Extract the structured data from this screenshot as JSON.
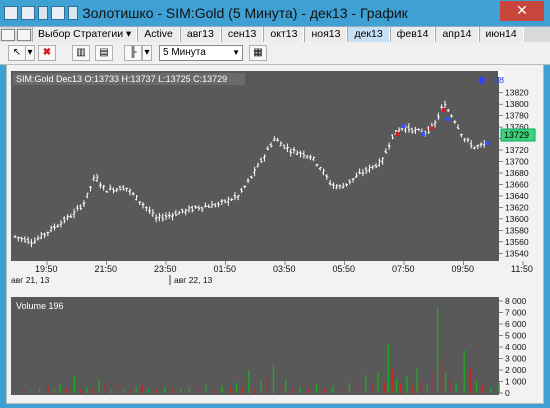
{
  "window": {
    "title": "Золотишко - SIM:Gold (5 Минута) - дек13 - График",
    "close_label": "✕"
  },
  "tabs": [
    {
      "label": "Выбор Стратегии",
      "dropdown": true
    },
    {
      "label": "Active"
    },
    {
      "label": "авг13"
    },
    {
      "label": "сен13"
    },
    {
      "label": "окт13"
    },
    {
      "label": "ноя13"
    },
    {
      "label": "дек13",
      "active": true
    },
    {
      "label": "фев14"
    },
    {
      "label": "апр14"
    },
    {
      "label": "июн14"
    }
  ],
  "toolbar": {
    "delete_icon": "✖",
    "interval_value": "5 Минута"
  },
  "chart": {
    "info_label": "SIM:Gold Dec13 O:13733 H:13737 L:13725 C:13729",
    "price_labels": [
      "13820",
      "13800",
      "13780",
      "13760",
      "13740",
      "13720",
      "13700",
      "13680",
      "13660",
      "13640",
      "13620",
      "13600",
      "13580",
      "13560",
      "13540"
    ],
    "last_price": "13729",
    "alert_label": "+28",
    "time_labels": [
      "19:50",
      "21:50",
      "23:50",
      "01:50",
      "03:50",
      "05:50",
      "07:50",
      "09:50",
      "11:50"
    ],
    "date_labels": [
      "авг 21, 13",
      "авг 22, 13"
    ],
    "volume_label": "Volume 196",
    "volume_labels": [
      "8 000",
      "7 000",
      "6 000",
      "5 000",
      "4 000",
      "3 000",
      "2 000",
      "1 000",
      "0"
    ],
    "colors": {
      "background": "#595959",
      "bars": "#ffffff",
      "up_volume": "#22aa22",
      "down_volume": "#cc2222",
      "last_price": "#3fd07a"
    }
  },
  "chart_data": {
    "type": "ohlc",
    "timeframe": "5 Минута",
    "ylim": [
      13530,
      13830
    ],
    "price_path": [
      [
        0,
        13570
      ],
      [
        20,
        13560
      ],
      [
        40,
        13585
      ],
      [
        60,
        13610
      ],
      [
        70,
        13630
      ],
      [
        80,
        13675
      ],
      [
        90,
        13650
      ],
      [
        110,
        13655
      ],
      [
        130,
        13620
      ],
      [
        140,
        13600
      ],
      [
        160,
        13610
      ],
      [
        180,
        13620
      ],
      [
        200,
        13625
      ],
      [
        220,
        13640
      ],
      [
        235,
        13680
      ],
      [
        245,
        13710
      ],
      [
        255,
        13740
      ],
      [
        270,
        13720
      ],
      [
        290,
        13710
      ],
      [
        300,
        13690
      ],
      [
        310,
        13660
      ],
      [
        320,
        13655
      ],
      [
        340,
        13680
      ],
      [
        350,
        13690
      ],
      [
        360,
        13700
      ],
      [
        370,
        13745
      ],
      [
        380,
        13760
      ],
      [
        390,
        13755
      ],
      [
        400,
        13750
      ],
      [
        410,
        13760
      ],
      [
        420,
        13800
      ],
      [
        430,
        13775
      ],
      [
        440,
        13740
      ],
      [
        450,
        13725
      ],
      [
        460,
        13729
      ]
    ],
    "markers": [
      {
        "t": 375,
        "price": 13748,
        "color": "#cc2222"
      },
      {
        "t": 381,
        "price": 13762,
        "color": "#3355ff"
      },
      {
        "t": 400,
        "price": 13748,
        "color": "#3355ff"
      },
      {
        "t": 408,
        "price": 13758,
        "color": "#cc2222"
      },
      {
        "t": 420,
        "price": 13790,
        "color": "#cc2222"
      },
      {
        "t": 424,
        "price": 13774,
        "color": "#3355ff"
      },
      {
        "t": 462,
        "price": 13732,
        "color": "#3355ff"
      }
    ],
    "volume_ylim": [
      0,
      8000
    ],
    "volume": [
      [
        10,
        300,
        "d"
      ],
      [
        18,
        200,
        "u"
      ],
      [
        26,
        400,
        "u"
      ],
      [
        34,
        600,
        "d"
      ],
      [
        40,
        300,
        "u"
      ],
      [
        46,
        700,
        "u"
      ],
      [
        52,
        400,
        "d"
      ],
      [
        60,
        1500,
        "u"
      ],
      [
        66,
        300,
        "d"
      ],
      [
        72,
        500,
        "u"
      ],
      [
        78,
        400,
        "d"
      ],
      [
        84,
        1200,
        "u"
      ],
      [
        90,
        800,
        "d"
      ],
      [
        96,
        300,
        "u"
      ],
      [
        102,
        900,
        "d"
      ],
      [
        108,
        400,
        "u"
      ],
      [
        114,
        300,
        "d"
      ],
      [
        120,
        500,
        "u"
      ],
      [
        126,
        700,
        "d"
      ],
      [
        132,
        400,
        "u"
      ],
      [
        140,
        300,
        "d"
      ],
      [
        148,
        500,
        "u"
      ],
      [
        156,
        400,
        "d"
      ],
      [
        164,
        300,
        "u"
      ],
      [
        172,
        600,
        "u"
      ],
      [
        180,
        500,
        "d"
      ],
      [
        188,
        700,
        "u"
      ],
      [
        196,
        300,
        "d"
      ],
      [
        204,
        600,
        "u"
      ],
      [
        212,
        400,
        "d"
      ],
      [
        218,
        900,
        "u"
      ],
      [
        224,
        500,
        "d"
      ],
      [
        230,
        2000,
        "u"
      ],
      [
        236,
        400,
        "d"
      ],
      [
        242,
        1000,
        "u"
      ],
      [
        248,
        1500,
        "d"
      ],
      [
        254,
        2500,
        "u"
      ],
      [
        260,
        600,
        "d"
      ],
      [
        266,
        1200,
        "u"
      ],
      [
        272,
        400,
        "d"
      ],
      [
        280,
        500,
        "u"
      ],
      [
        288,
        300,
        "d"
      ],
      [
        296,
        800,
        "u"
      ],
      [
        304,
        400,
        "d"
      ],
      [
        312,
        600,
        "u"
      ],
      [
        320,
        300,
        "d"
      ],
      [
        328,
        900,
        "u"
      ],
      [
        336,
        500,
        "d"
      ],
      [
        344,
        1600,
        "u"
      ],
      [
        350,
        700,
        "d"
      ],
      [
        356,
        1800,
        "u"
      ],
      [
        362,
        900,
        "d"
      ],
      [
        366,
        4300,
        "u"
      ],
      [
        370,
        2100,
        "d"
      ],
      [
        374,
        1200,
        "u"
      ],
      [
        378,
        800,
        "d"
      ],
      [
        384,
        1400,
        "u"
      ],
      [
        390,
        600,
        "d"
      ],
      [
        394,
        2200,
        "u"
      ],
      [
        398,
        1000,
        "d"
      ],
      [
        404,
        700,
        "u"
      ],
      [
        410,
        2000,
        "d"
      ],
      [
        414,
        7500,
        "u"
      ],
      [
        418,
        3000,
        "d"
      ],
      [
        422,
        1800,
        "u"
      ],
      [
        426,
        1200,
        "d"
      ],
      [
        432,
        900,
        "u"
      ],
      [
        440,
        3700,
        "u"
      ],
      [
        446,
        2100,
        "d"
      ],
      [
        452,
        1000,
        "u"
      ],
      [
        458,
        700,
        "d"
      ],
      [
        466,
        500,
        "u"
      ],
      [
        474,
        900,
        "u"
      ]
    ]
  }
}
